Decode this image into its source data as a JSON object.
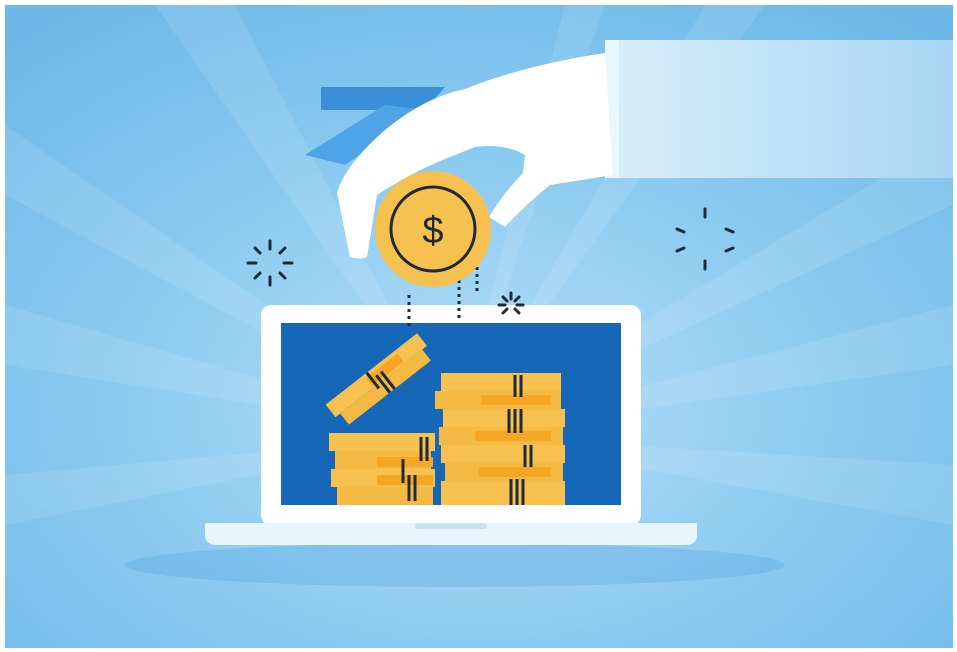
{
  "illustration": {
    "coin_symbol": "$",
    "colors": {
      "background_light": "#a9d8f5",
      "background_mid": "#7ec4ee",
      "background_dark": "#5fb1e6",
      "screen_blue": "#1667b8",
      "laptop_white": "#ffffff",
      "laptop_base": "#e6f3fb",
      "coin_gold": "#f6c14e",
      "coin_orange": "#f5a623",
      "outline_dark": "#1d2a3a",
      "cuff_blue": "#3a8fd8",
      "sleeve_light": "#c4e4f8"
    },
    "icons": [
      "hand-icon",
      "coin-icon",
      "laptop-icon",
      "coin-stacks-icon",
      "sparkle-icon"
    ]
  }
}
